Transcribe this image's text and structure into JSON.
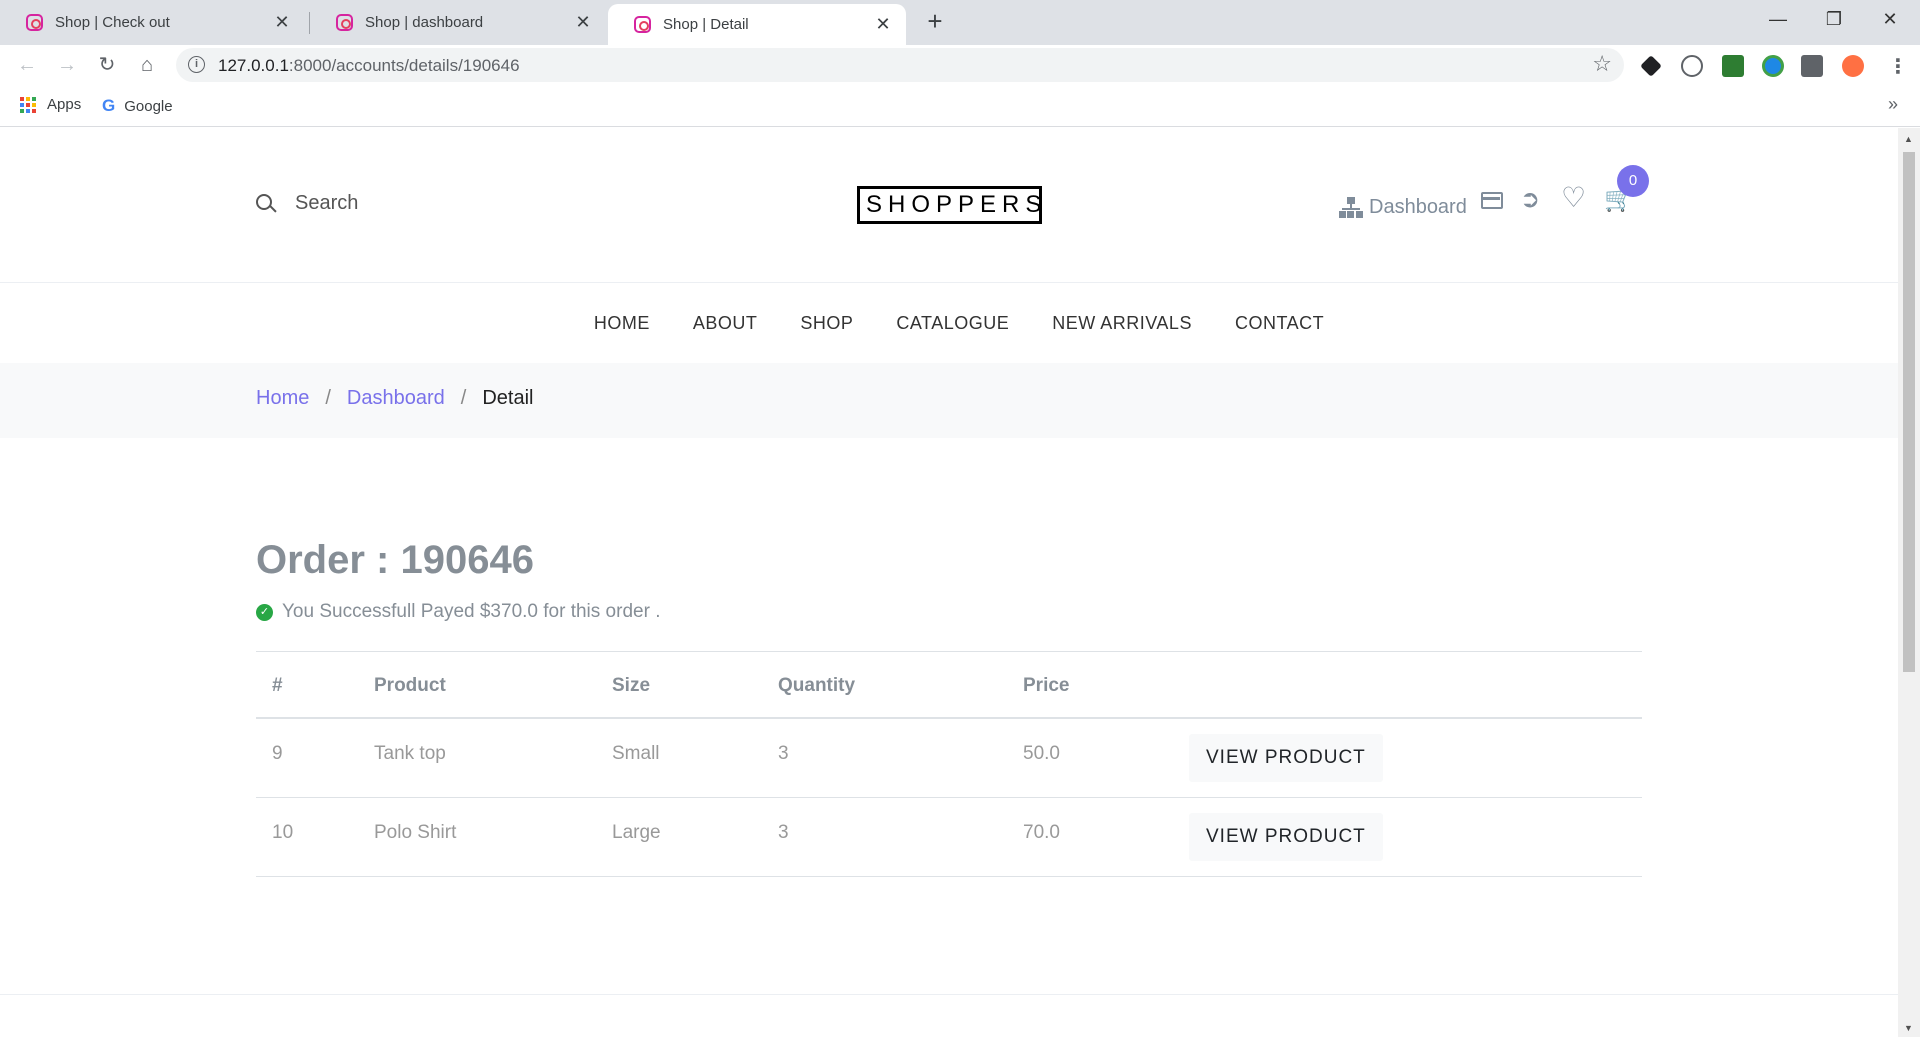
{
  "browser": {
    "tabs": [
      {
        "title": "Shop | Check out",
        "active": false
      },
      {
        "title": "Shop | dashboard",
        "active": false
      },
      {
        "title": "Shop | Detail",
        "active": true
      }
    ],
    "close_glyph": "✕",
    "new_tab_glyph": "+",
    "url_host": "127.0.0.1",
    "url_path": ":8000/accounts/details/190646",
    "bookmarks": [
      {
        "label": "Apps",
        "icon": "apps-grid-icon"
      },
      {
        "label": "Google",
        "icon": "google-icon"
      }
    ],
    "more_bookmarks": "»",
    "window_controls": [
      "minimize",
      "restore",
      "close"
    ]
  },
  "header": {
    "search_placeholder": "Search",
    "logo": "SHOPPERS",
    "dashboard_label": "Dashboard",
    "cart_count": "0",
    "icons": [
      "sitemap-icon",
      "credit-card-icon",
      "logout-icon",
      "heart-icon",
      "cart-icon"
    ]
  },
  "nav": {
    "items": [
      "HOME",
      "ABOUT",
      "SHOP",
      "CATALOGUE",
      "NEW ARRIVALS",
      "CONTACT"
    ]
  },
  "breadcrumb": {
    "home": "Home",
    "dashboard": "Dashboard",
    "current": "Detail",
    "separator": "/"
  },
  "order": {
    "title": "Order : 190646",
    "success_message": "You Successfull Payed $370.0 for this order .",
    "columns": [
      "#",
      "Product",
      "Size",
      "Quantity",
      "Price"
    ],
    "rows": [
      {
        "id": "9",
        "product": "Tank top",
        "size": "Small",
        "quantity": "3",
        "price": "50.0",
        "action": "VIEW PRODUCT"
      },
      {
        "id": "10",
        "product": "Polo Shirt",
        "size": "Large",
        "quantity": "3",
        "price": "70.0",
        "action": "VIEW PRODUCT"
      }
    ]
  },
  "colors": {
    "accent": "#7971ea",
    "success": "#28a745",
    "muted_text": "#868e96"
  }
}
